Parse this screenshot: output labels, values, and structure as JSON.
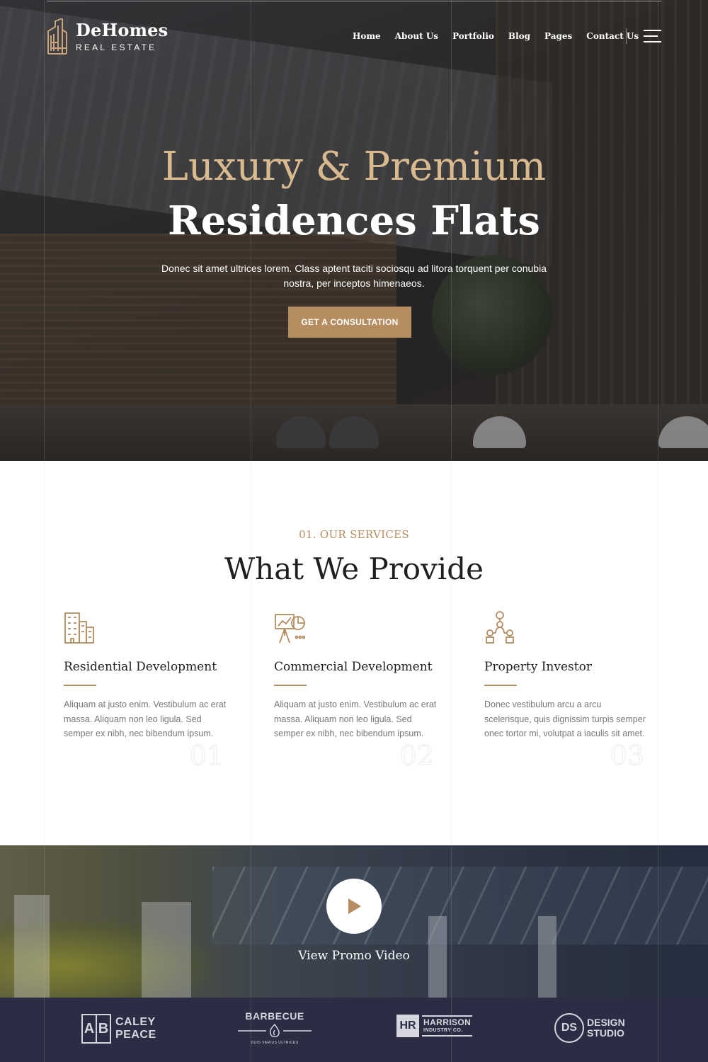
{
  "header": {
    "logo_name": "DeHomes",
    "logo_sub": "REAL ESTATE",
    "nav": [
      "Home",
      "About Us",
      "Portfolio",
      "Blog",
      "Pages",
      "Contact Us"
    ],
    "menu_icon": "hamburger-menu-icon"
  },
  "hero": {
    "title_line1": "Luxury & Premium",
    "title_line2": "Residences Flats",
    "description": "Donec sit amet ultrices lorem. Class aptent taciti sociosqu ad litora torquent per conubia nostra, per inceptos himenaeos.",
    "cta_label": "GET A CONSULTATION"
  },
  "services": {
    "eyebrow": "01. OUR SERVICES",
    "title": "What We Provide",
    "items": [
      {
        "icon": "buildings-icon",
        "title": "Residential Development",
        "text": "Aliquam at justo enim. Vestibulum ac erat massa. Aliquam non leo ligula. Sed semper ex nibh, nec bibendum ipsum.",
        "number": "01"
      },
      {
        "icon": "presentation-chart-icon",
        "title": "Commercial Development",
        "text": "Aliquam at justo enim. Vestibulum ac erat massa. Aliquam non leo ligula. Sed semper ex nibh, nec bibendum ipsum.",
        "number": "02"
      },
      {
        "icon": "investor-network-icon",
        "title": "Property Investor",
        "text": "Donec vestibulum arcu a arcu scelerisque, quis dignissim turpis semper onec tortor mi, volutpat a iaculis sit amet.",
        "number": "03"
      }
    ]
  },
  "promo": {
    "play_icon": "play-icon",
    "label": "View Promo Video"
  },
  "clients": {
    "caley_peace": {
      "mark_a": "A",
      "mark_b": "B",
      "line1": "CALEY",
      "line2": "PEACE"
    },
    "barbecue": {
      "name": "BARBECUE",
      "tagline": "DUIS VARIUS ULTRICES"
    },
    "harrison": {
      "mark": "HR",
      "line1": "HARRISON",
      "line2": "INDUSTRY CO."
    },
    "design_studio": {
      "mark": "DS",
      "line1": "DESIGN",
      "line2": "STUDIO"
    }
  },
  "colors": {
    "accent": "#b58d60",
    "hero_title_gold": "#d9b98e",
    "clients_bg": "#2c2c44"
  }
}
